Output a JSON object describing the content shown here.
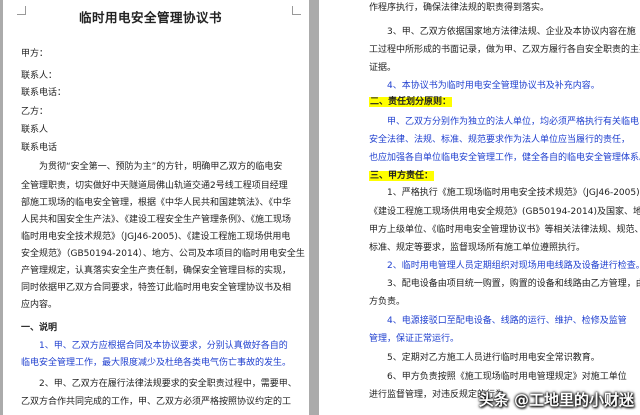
{
  "left_page": {
    "title": "临时用电安全管理协议书",
    "lines": [
      "甲方：",
      "联系人：",
      "联系电话：",
      "乙方：",
      "联系人",
      "联系电话",
      "为贯彻“安全第一、预防为主”的方针，明确甲乙双方的临电安",
      "全管理职责，切实做好中天隧道局佛山轨道交通2号线工程项目经理",
      "部施工现场的临电安全管理，根据《中华人民共和国建筑法》、《中华",
      "人民共和国安全生产法》、《建设工程安全生产管理条例》、《施工现场",
      "临时用电安全技术规范》（JGJ46-2005)、《建设工程施工现场供用电",
      "安全规范》（GB50194-2014）、地方、公司及本项目的临时用电安全生",
      "产管理规定，认真落实安全生产责任制，确保安全管理目标的实现，",
      "同时依据甲乙双方合同要求，特签订此临时用电安全管理协议书及相",
      "应内容。",
      "一、说明",
      "1、甲、乙双方应根据合同及本协议要求，分别认真做好各自的",
      "临电安全管理工作，最大限度减少及杜绝各类电气伤亡事故的发生。",
      "2、甲、乙双方在履行法律法规要求的安全职责过程中，需要甲、",
      "乙双方合作共同完成的工作，甲、乙双方必须严格按照协议约定的工"
    ]
  },
  "right_page": {
    "lines": [
      "作程序执行，确保法律法规的职责得到落实。",
      "3、甲、乙双方依据国家地方法律法规、企业及本协议内容在施",
      "工过程中所形成的书面记录，做为甲、乙双方履行各自安全职责的主要",
      "证据。",
      "4、本协议书为临时用电安全管理协议书及补充内容。",
      "二、责任划分原则：",
      "甲、乙双方分别作为独立的法人单位，均必须严格执行有关临电",
      "安全法律、法规、标准、规范要求作为法人单位应当履行的责任，",
      "也应加强各自单位临电安全管理工作，健全各自的临电安全管理体系。",
      "三、甲方责任：",
      "1、严格执行《施工现场临时用电安全技术规范》（JGJ46-2005)、",
      "《建设工程施工现场供用电安全规范》(GB50194-2014)及国家、地方、",
      "甲方上级单位、《临时用电安全管理协议书》等相关法律法规、规范、",
      "标准、规定等要求，监督现场所有施工单位遵照执行。",
      "2、临时用电管理人员定期组织对现场用电线路及设备进行检查。",
      "3、配电设备由项目统一购置，购置的设备和线路由乙方管理，由甲",
      "方负责。",
      "4、电源接驳口至配电设备、线路的运行、维护、检修及监管",
      "管理，保证正常运行。",
      "5、定期对乙方施工人员进行临时用电安全常识教育。",
      "6、甲方负责按照《施工现场临时用电管理规定》对施工单位",
      "进行监督管理，对违反规定的行为"
    ]
  },
  "watermark": "头条 @工地里的小财迷",
  "colors": {
    "blue_text": "#1f3fcf",
    "highlight": "#ffff00",
    "gutter": "#ababab"
  }
}
